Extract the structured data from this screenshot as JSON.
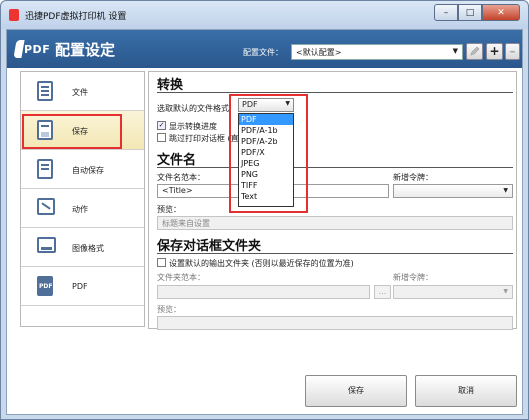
{
  "window": {
    "title": "迅捷PDF虚拟打印机 设置",
    "minimize": "–",
    "maximize": "□",
    "close": "✕"
  },
  "header": {
    "logo_text": "PDF",
    "title": "配置设定",
    "profile_label": "配置文件：",
    "profile_value": "<默认配置>",
    "edit_icon": "pencil-icon",
    "add_label": "+",
    "remove_label": "–"
  },
  "sidebar": {
    "items": [
      {
        "label": "文件",
        "icon": "document-icon",
        "active": false
      },
      {
        "label": "保存",
        "icon": "save-icon",
        "active": true
      },
      {
        "label": "自动保存",
        "icon": "autosave-icon",
        "active": false
      },
      {
        "label": "动作",
        "icon": "action-icon",
        "active": false
      },
      {
        "label": "图像格式",
        "icon": "image-icon",
        "active": false
      },
      {
        "label": "PDF",
        "icon": "pdf-icon",
        "active": false
      }
    ]
  },
  "convert": {
    "title": "转换",
    "format_label": "选取默认的文件格式",
    "format_value": "PDF",
    "format_options": [
      "PDF",
      "PDF/A-1b",
      "PDF/A-2b",
      "PDF/X",
      "JPEG",
      "PNG",
      "TIFF",
      "Text"
    ],
    "selected_option": "PDF",
    "show_progress_label": "显示转换进度",
    "show_progress_checked": true,
    "skip_dialog_label": "跳过打印对话框 (直接",
    "skip_dialog_checked": false
  },
  "filename": {
    "title": "文件名",
    "template_label": "文件名范本：",
    "template_value": "<Title>",
    "token_label": "新增令牌：",
    "preview_label": "预览：",
    "preview_value": "标题来自设置"
  },
  "save_dialog_folder": {
    "title": "保存对话框文件夹",
    "default_folder_label": "设置默认的输出文件夹 (否则以最近保存的位置为准)",
    "default_folder_checked": false,
    "folder_template_label": "文件夹范本：",
    "browse_label": "...",
    "token_label": "新增令牌：",
    "preview_label": "预览："
  },
  "footer": {
    "save_label": "保存",
    "cancel_label": "取消"
  },
  "colors": {
    "header_bg": "#2a578d",
    "highlight": "#e53030",
    "selection": "#3399ff",
    "active_item": "#f3e7b4"
  }
}
